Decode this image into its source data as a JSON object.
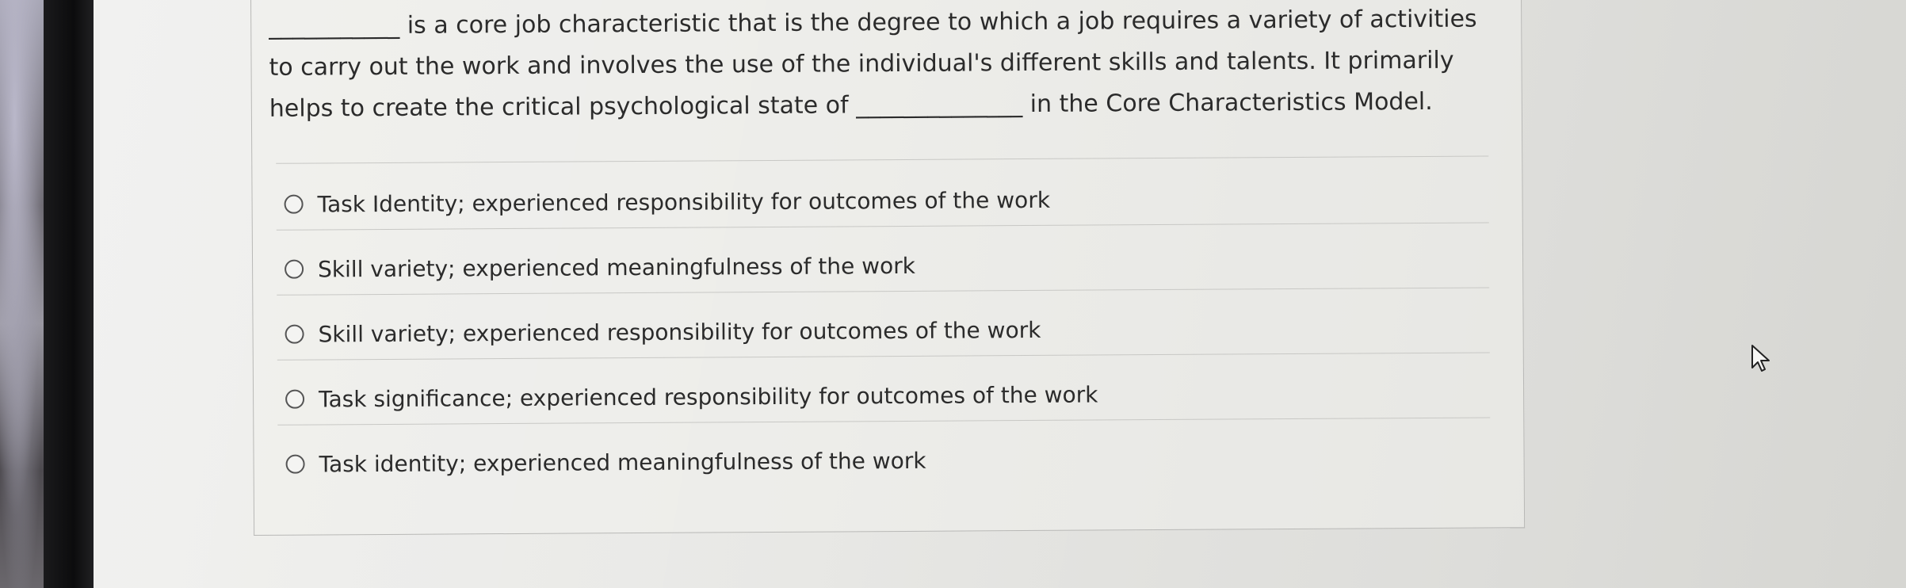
{
  "question": {
    "text": "___________ is a core job characteristic that is the degree to which a job requires a variety of activities to carry out the work and involves the use of the individual's different skills and talents.  It primarily helps to create the critical psychological state of ______________ in the Core Characteristics Model."
  },
  "options": [
    {
      "label": "Task Identity; experienced responsibility for outcomes of the work",
      "selected": false
    },
    {
      "label": "Skill variety; experienced meaningfulness of the work",
      "selected": false
    },
    {
      "label": "Skill variety; experienced responsibility for outcomes of the work",
      "selected": false
    },
    {
      "label": "Task significance; experienced responsibility for outcomes of the work",
      "selected": false
    },
    {
      "label": "Task identity; experienced meaningfulness of the work",
      "selected": false
    }
  ],
  "icons": {
    "radio": "radio-button-icon",
    "cursor": "mouse-pointer-icon"
  }
}
